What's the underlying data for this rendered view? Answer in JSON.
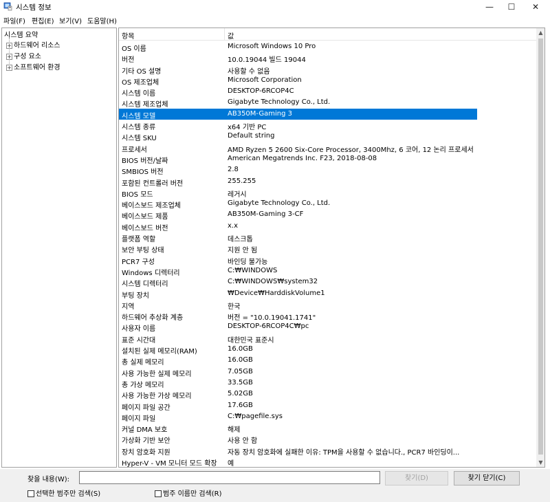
{
  "window": {
    "title": "시스템 정보",
    "minimize": "—",
    "maximize": "☐",
    "close": "✕"
  },
  "menu": [
    "파일(F)",
    "편집(E)",
    "보기(V)",
    "도움말(H)"
  ],
  "tree": {
    "root": "시스템 요약",
    "nodes": [
      "하드웨어 리소스",
      "구성 요소",
      "소프트웨어 환경"
    ]
  },
  "list": {
    "headers": [
      "항목",
      "값"
    ],
    "selected_index": 6,
    "rows": [
      [
        "OS 이름",
        "Microsoft Windows 10 Pro"
      ],
      [
        "버전",
        "10.0.19044 빌드 19044"
      ],
      [
        "기타 OS 설명",
        "사용할 수 없음"
      ],
      [
        "OS 제조업체",
        "Microsoft Corporation"
      ],
      [
        "시스템 이름",
        "DESKTOP-6RCOP4C"
      ],
      [
        "시스템 제조업체",
        "Gigabyte Technology Co., Ltd."
      ],
      [
        "시스템 모델",
        "AB350M-Gaming 3"
      ],
      [
        "시스템 종류",
        "x64 기반 PC"
      ],
      [
        "시스템 SKU",
        "Default string"
      ],
      [
        "프로세서",
        "AMD Ryzen 5 2600 Six-Core Processor, 3400Mhz, 6 코어, 12 논리 프로세서"
      ],
      [
        "BIOS 버전/날짜",
        "American Megatrends Inc. F23, 2018-08-08"
      ],
      [
        "SMBIOS 버전",
        "2.8"
      ],
      [
        "포함된 컨트롤러 버전",
        "255.255"
      ],
      [
        "BIOS 모드",
        "레거시"
      ],
      [
        "베이스보드 제조업체",
        "Gigabyte Technology Co., Ltd."
      ],
      [
        "베이스보드 제품",
        "AB350M-Gaming 3-CF"
      ],
      [
        "베이스보드 버전",
        "x.x"
      ],
      [
        "플랫폼 역할",
        "데스크톱"
      ],
      [
        "보안 부팅 상태",
        "지원 안 됨"
      ],
      [
        "PCR7 구성",
        "바인딩 불가능"
      ],
      [
        "Windows 디렉터리",
        "C:₩WINDOWS"
      ],
      [
        "시스템 디렉터리",
        "C:₩WINDOWS₩system32"
      ],
      [
        "부팅 장치",
        "₩Device₩HarddiskVolume1"
      ],
      [
        "지역",
        "한국"
      ],
      [
        "하드웨어 추상화 계층",
        "버전 = \"10.0.19041.1741\""
      ],
      [
        "사용자 이름",
        "DESKTOP-6RCOP4C₩pc"
      ],
      [
        "표준 시간대",
        "대한민국 표준시"
      ],
      [
        "설치된 실제 메모리(RAM)",
        "16.0GB"
      ],
      [
        "총 실제 메모리",
        "16.0GB"
      ],
      [
        "사용 가능한 실제 메모리",
        "7.05GB"
      ],
      [
        "총 가상 메모리",
        "33.5GB"
      ],
      [
        "사용 가능한 가상 메모리",
        "5.02GB"
      ],
      [
        "페이지 파일 공간",
        "17.6GB"
      ],
      [
        "페이지 파일",
        "C:₩pagefile.sys"
      ],
      [
        "커널 DMA 보호",
        "해제"
      ],
      [
        "가상화 기반 보안",
        "사용 안 함"
      ],
      [
        "장치 암호화 지원",
        "자동 장치 암호화에 실패한 이유: TPM을 사용할 수 없습니다., PCR7 바인딩이..."
      ],
      [
        "Hyper-V - VM 모니터 모드 확장",
        "예"
      ]
    ]
  },
  "search": {
    "label": "찾을 내용(W):",
    "value": "",
    "find_button": "찾기(D)",
    "close_button": "찾기 닫기(C)",
    "checkbox_selected_category": "선택한 범주만 검색(S)",
    "checkbox_category_names": "범주 이름만 검색(R)"
  },
  "colors": {
    "selection": "#0078d7"
  }
}
